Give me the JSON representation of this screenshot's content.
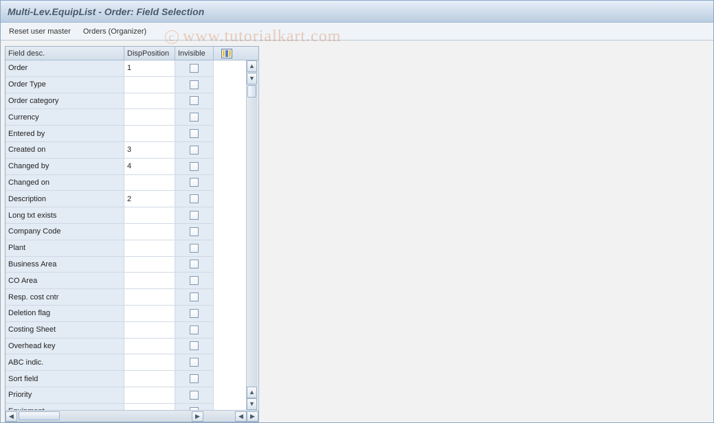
{
  "title": "Multi-Lev.EquipList - Order: Field Selection",
  "appbar": {
    "reset": "Reset user master",
    "organizer": "Orders (Organizer)"
  },
  "table": {
    "headers": {
      "field_desc": "Field desc.",
      "disp_position": "DispPosition",
      "invisible": "Invisible"
    },
    "rows": [
      {
        "label": "Order",
        "disp": "1",
        "inv": false
      },
      {
        "label": "Order Type",
        "disp": "",
        "inv": false
      },
      {
        "label": "Order category",
        "disp": "",
        "inv": false
      },
      {
        "label": "Currency",
        "disp": "",
        "inv": false
      },
      {
        "label": "Entered by",
        "disp": "",
        "inv": false
      },
      {
        "label": "Created on",
        "disp": "3",
        "inv": false
      },
      {
        "label": "Changed by",
        "disp": "4",
        "inv": false
      },
      {
        "label": "Changed on",
        "disp": "",
        "inv": false
      },
      {
        "label": "Description",
        "disp": "2",
        "inv": false
      },
      {
        "label": "Long txt exists",
        "disp": "",
        "inv": false
      },
      {
        "label": "Company Code",
        "disp": "",
        "inv": false
      },
      {
        "label": "Plant",
        "disp": "",
        "inv": false
      },
      {
        "label": "Business Area",
        "disp": "",
        "inv": false
      },
      {
        "label": "CO Area",
        "disp": "",
        "inv": false
      },
      {
        "label": "Resp. cost cntr",
        "disp": "",
        "inv": false
      },
      {
        "label": "Deletion flag",
        "disp": "",
        "inv": false
      },
      {
        "label": "Costing Sheet",
        "disp": "",
        "inv": false
      },
      {
        "label": "Overhead key",
        "disp": "",
        "inv": false
      },
      {
        "label": "ABC indic.",
        "disp": "",
        "inv": false
      },
      {
        "label": "Sort field",
        "disp": "",
        "inv": false
      },
      {
        "label": "Priority",
        "disp": "",
        "inv": false
      },
      {
        "label": "Equipment",
        "disp": "",
        "inv": false
      }
    ]
  },
  "watermark": "www.tutorialkart.com"
}
